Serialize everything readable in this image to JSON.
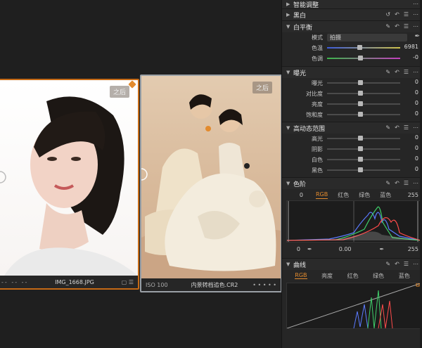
{
  "browser": {
    "thumb1": {
      "badge": "之后",
      "caption_left": "-- -- --",
      "filename": "IMG_1668.JPG"
    },
    "thumb2": {
      "badge": "之后",
      "caption_left": "ISO 100",
      "filename": "内景转档追色.CR2",
      "caption_right": "• • • • •"
    }
  },
  "panel": {
    "top_section": "智能调整",
    "bw": {
      "title": "黑白"
    },
    "wb": {
      "title": "白平衡",
      "mode_label": "模式",
      "mode_value": "拍摄",
      "temp_label": "色温",
      "temp_value": "6981",
      "temp_level": 0.44,
      "tint_label": "色调",
      "tint_value": "-0",
      "tint_level": 0.45
    },
    "exposure": {
      "title": "曝光",
      "rows": [
        {
          "label": "曝光",
          "value": "0",
          "level": 0.45
        },
        {
          "label": "对比度",
          "value": "0",
          "level": 0.45
        },
        {
          "label": "亮度",
          "value": "0",
          "level": 0.45
        },
        {
          "label": "饱和度",
          "value": "0",
          "level": 0.45
        }
      ]
    },
    "hdr": {
      "title": "高动态范围",
      "rows": [
        {
          "label": "高光",
          "value": "0",
          "level": 0.45
        },
        {
          "label": "阴影",
          "value": "0",
          "level": 0.45
        },
        {
          "label": "白色",
          "value": "0",
          "level": 0.45
        },
        {
          "label": "黑色",
          "value": "0",
          "level": 0.45
        }
      ]
    },
    "levels": {
      "title": "色阶",
      "left_value": "0",
      "right_value": "255",
      "tabs": [
        "RGB",
        "红色",
        "绿色",
        "蓝色"
      ],
      "bottom_left": "0",
      "bottom_mid": "0.00",
      "bottom_right": "255"
    },
    "curves": {
      "title": "曲线",
      "tabs": [
        "RGB",
        "亮度",
        "红色",
        "绿色",
        "蓝色"
      ]
    }
  },
  "colors": {
    "accent": "#e38b2e",
    "selected_border": "#c56a16"
  }
}
